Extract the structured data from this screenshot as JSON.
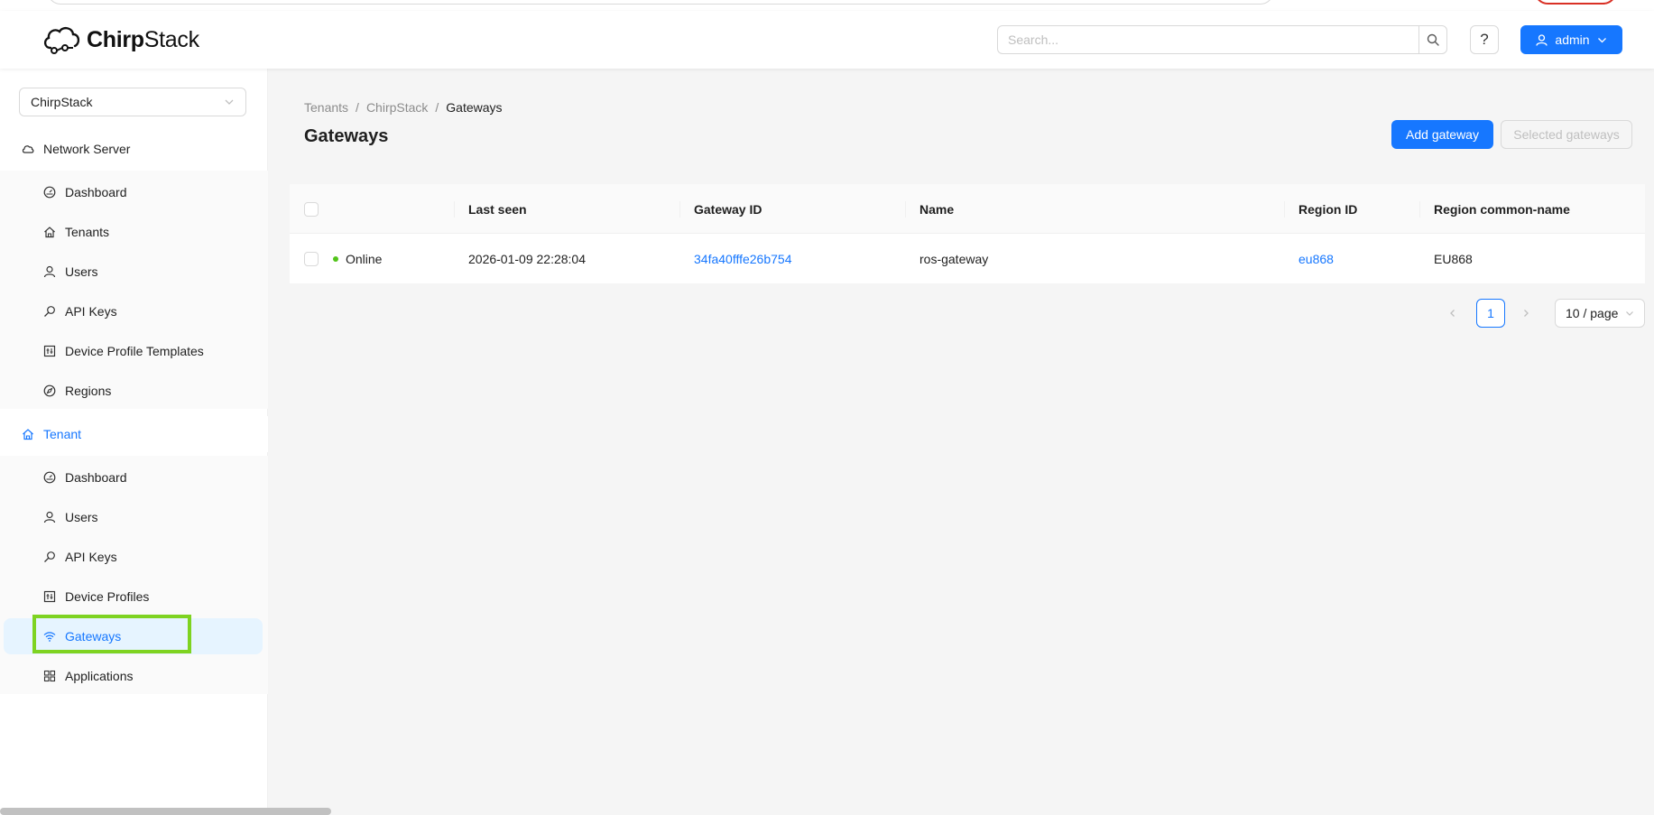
{
  "app": {
    "logo_text_bold": "Chirp",
    "logo_text_rest": "Stack"
  },
  "header": {
    "search_placeholder": "Search...",
    "help_label": "?",
    "user_label": "admin"
  },
  "sidebar": {
    "tenant_selector": "ChirpStack",
    "network_server": {
      "title": "Network Server",
      "items": [
        {
          "label": "Dashboard",
          "icon": "dashboard-icon"
        },
        {
          "label": "Tenants",
          "icon": "home-icon"
        },
        {
          "label": "Users",
          "icon": "user-icon"
        },
        {
          "label": "API Keys",
          "icon": "key-icon"
        },
        {
          "label": "Device Profile Templates",
          "icon": "profile-icon"
        },
        {
          "label": "Regions",
          "icon": "compass-icon"
        }
      ]
    },
    "tenant": {
      "title": "Tenant",
      "items": [
        {
          "label": "Dashboard",
          "icon": "dashboard-icon"
        },
        {
          "label": "Users",
          "icon": "user-icon"
        },
        {
          "label": "API Keys",
          "icon": "key-icon"
        },
        {
          "label": "Device Profiles",
          "icon": "profile-icon"
        },
        {
          "label": "Gateways",
          "icon": "wifi-icon",
          "selected": true
        },
        {
          "label": "Applications",
          "icon": "apps-icon"
        }
      ]
    }
  },
  "main": {
    "breadcrumb": [
      "Tenants",
      "ChirpStack",
      "Gateways"
    ],
    "breadcrumb_separator": "/",
    "title": "Gateways",
    "add_button": "Add gateway",
    "selected_button": "Selected gateways",
    "table": {
      "columns": [
        "Last seen",
        "Gateway ID",
        "Name",
        "Region ID",
        "Region common-name"
      ],
      "rows": [
        {
          "status": "Online",
          "last_seen": "2026-01-09 22:28:04",
          "gateway_id": "34fa40fffe26b754",
          "name": "ros-gateway",
          "region_id": "eu868",
          "region_common_name": "EU868"
        }
      ]
    },
    "pagination": {
      "prev": "<",
      "current_page": "1",
      "next": ">",
      "page_size": "10 / page"
    }
  },
  "colors": {
    "primary": "#1677ff",
    "online": "#52c41a",
    "highlight": "#7ed321"
  }
}
